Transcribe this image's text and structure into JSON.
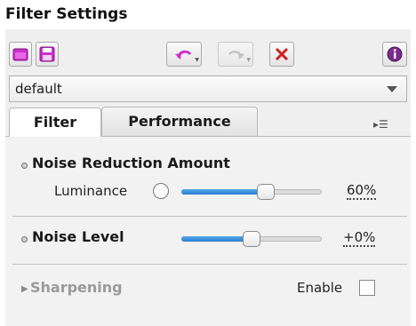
{
  "panel": {
    "title": "Filter Settings"
  },
  "toolbar": {
    "buttons": [
      {
        "name": "open-preset-button",
        "icon": "folder-icon",
        "color": "#cc2fcc"
      },
      {
        "name": "save-preset-button",
        "icon": "floppy-disk-icon",
        "color": "#cc2fcc"
      },
      {
        "name": "undo-button",
        "icon": "undo-icon",
        "color": "#cc2fcc"
      },
      {
        "name": "redo-button",
        "icon": "redo-icon",
        "color": "#9a9a9a"
      },
      {
        "name": "reset-button",
        "icon": "close-icon",
        "color": "#d02020"
      },
      {
        "name": "info-button",
        "icon": "info-icon",
        "color": "#7a2a8a"
      }
    ]
  },
  "preset": {
    "value": "default"
  },
  "tabs": [
    {
      "label": "Filter",
      "active": true
    },
    {
      "label": "Performance",
      "active": false
    }
  ],
  "tab_menu_icon": "tab-menu-icon",
  "sections": {
    "noise_reduction": {
      "title": "Noise Reduction Amount",
      "luminance_label": "Luminance",
      "luminance_value": "60%",
      "luminance_level": 0.6
    },
    "noise_level": {
      "title": "Noise Level",
      "value": "+0%",
      "level": 0.5
    },
    "sharpening": {
      "title": "Sharpening",
      "enable_label": "Enable",
      "enabled": false
    }
  },
  "colors": {
    "slider_fill": "#2a7fd0",
    "accent": "#cc2fcc"
  }
}
